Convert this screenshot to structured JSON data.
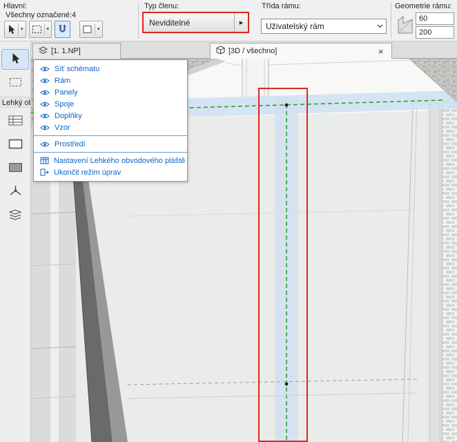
{
  "colors": {
    "highlight_red": "#e0251c",
    "selection_green": "#2f9e2f",
    "selection_blue_band": "#cfe0f1",
    "popup_blue": "#0a64c8"
  },
  "icons": {
    "dropdown_caret": "▾",
    "submenu_arrow": "▸",
    "close": "×"
  },
  "toolbar": {
    "main": {
      "label": "Hlavní:",
      "selection_info": "Všechny označené:4"
    },
    "member_type": {
      "label": "Typ členu:",
      "value": "Neviditelné"
    },
    "frame_class": {
      "label": "Třída rámu:",
      "value": "Uživatelský rám"
    },
    "frame_geometry": {
      "label": "Geometrie rámu:",
      "width_value": "60",
      "height_value": "200"
    }
  },
  "palette": {
    "section_label": "Lehký ob"
  },
  "tabs": [
    {
      "label": "[1. 1.NP]"
    },
    {
      "label": "[3D / všechno]"
    }
  ],
  "popup": {
    "items": [
      {
        "icon": "eye-icon",
        "label": "Síť schématu"
      },
      {
        "icon": "eye-icon",
        "label": "Rám"
      },
      {
        "icon": "eye-icon",
        "label": "Panely"
      },
      {
        "icon": "eye-icon",
        "label": "Spoje"
      },
      {
        "icon": "eye-icon",
        "label": "Doplňky"
      },
      {
        "icon": "eye-icon",
        "label": "Vzor"
      },
      {
        "icon": "eye-icon",
        "label": "Prostředí"
      },
      {
        "icon": "settings-grid-icon",
        "label": "Nastavení Lehkého obvodového pláště"
      },
      {
        "icon": "exit-icon",
        "label": "Ukončit režim úprav"
      }
    ]
  }
}
